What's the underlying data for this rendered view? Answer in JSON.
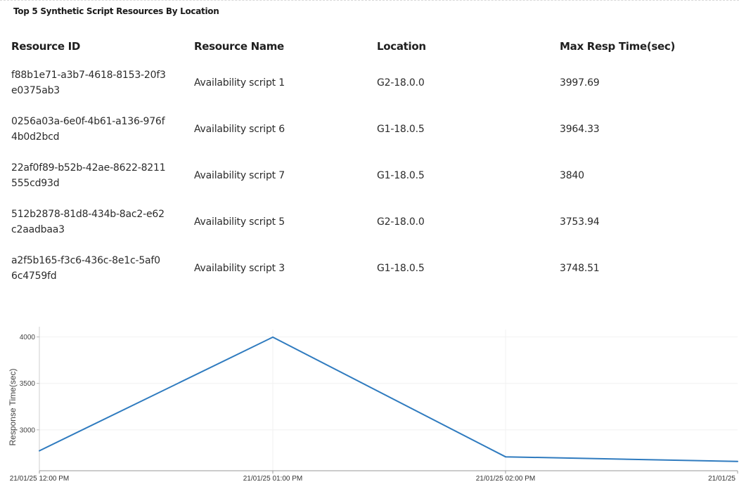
{
  "panel": {
    "title": "Top 5 Synthetic Script Resources By Location"
  },
  "table": {
    "headers": [
      "Resource ID",
      "Resource Name",
      "Location",
      "Max Resp Time(sec)"
    ],
    "rows": [
      {
        "id": "f88b1e71-a3b7-4618-8153-20f3e0375ab3",
        "name": "Availability script 1",
        "location": "G2-18.0.0",
        "max_resp": "3997.69"
      },
      {
        "id": "0256a03a-6e0f-4b61-a136-976f4b0d2bcd",
        "name": "Availability script 6",
        "location": "G1-18.0.5",
        "max_resp": "3964.33"
      },
      {
        "id": "22af0f89-b52b-42ae-8622-8211555cd93d",
        "name": "Availability script 7",
        "location": "G1-18.0.5",
        "max_resp": "3840"
      },
      {
        "id": "512b2878-81d8-434b-8ac2-e62c2aadbaa3",
        "name": "Availability script 5",
        "location": "G2-18.0.0",
        "max_resp": "3753.94"
      },
      {
        "id": "a2f5b165-f3c6-436c-8e1c-5af06c4759fd",
        "name": "Availability script 3",
        "location": "G1-18.0.5",
        "max_resp": "3748.51"
      }
    ]
  },
  "chart_data": {
    "type": "line",
    "title": "",
    "xlabel": "",
    "ylabel": "Response Time(sec)",
    "x": [
      "21/01/25 12:00 PM",
      "21/01/25 01:00 PM",
      "21/01/25 02:00 PM",
      "21/01/25"
    ],
    "series": [
      {
        "values": [
          2775,
          3997.69,
          2710,
          2660
        ]
      }
    ],
    "yticks": [
      3000,
      3500,
      4000
    ],
    "ylim": [
      2560,
      4080
    ],
    "grid": true,
    "line_color": "#2f7bbf"
  }
}
